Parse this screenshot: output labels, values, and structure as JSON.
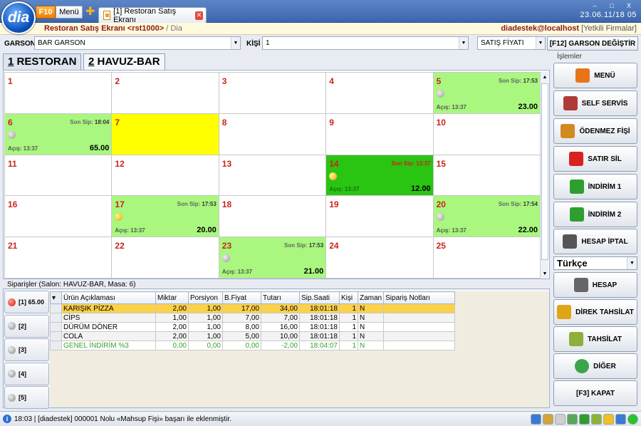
{
  "app": {
    "logo_text": "dia",
    "f10": "F10",
    "menu": "Menü",
    "tab_title": "[1] Restoran Satış Ekranı",
    "clock": "23.06.11/18 05"
  },
  "window_controls": {
    "minimize": "–",
    "maximize": "□",
    "close": "X"
  },
  "subbar": {
    "screen": "Restoran Satış Ekranı <rst1000>",
    "sep": " / ",
    "app": "Dia",
    "user": "diadestek@localhost",
    "firm": "[Yetkili Firmalar]"
  },
  "toolbar": {
    "garson_label": "GARSON",
    "garson_value": "BAR GARSON",
    "kisi_label": "KİŞİ",
    "kisi_value": "1",
    "price_value": "SATIŞ FİYATI",
    "change_button": "[F12] GARSON DEĞİŞTİR"
  },
  "salons": [
    {
      "key": "1",
      "label": " RESTORAN"
    },
    {
      "key": "2",
      "label": " HAVUZ-BAR"
    }
  ],
  "tables": [
    {
      "num": "1",
      "state": "free"
    },
    {
      "num": "2",
      "state": "free"
    },
    {
      "num": "3",
      "state": "free"
    },
    {
      "num": "4",
      "state": "free"
    },
    {
      "num": "5",
      "state": "busy",
      "last_label": "Son Sip:",
      "last": "17:53",
      "open": "Açış: 13:37",
      "total": "23.00",
      "dot": "gray"
    },
    {
      "num": "6",
      "state": "busy",
      "last_label": "Son Sip:",
      "last": "18:04",
      "open": "Açış: 13:37",
      "total": "65.00",
      "dot": "gray"
    },
    {
      "num": "7",
      "state": "reserved"
    },
    {
      "num": "8",
      "state": "free"
    },
    {
      "num": "9",
      "state": "free"
    },
    {
      "num": "10",
      "state": "free"
    },
    {
      "num": "11",
      "state": "free"
    },
    {
      "num": "12",
      "state": "free"
    },
    {
      "num": "13",
      "state": "free"
    },
    {
      "num": "14",
      "state": "active",
      "last_label": "Son Sip:",
      "last": "13:37",
      "open": "Açış: 13:37",
      "total": "12.00",
      "dot": "yellow"
    },
    {
      "num": "15",
      "state": "free"
    },
    {
      "num": "16",
      "state": "free"
    },
    {
      "num": "17",
      "state": "busy",
      "last_label": "Son Sip:",
      "last": "17:53",
      "open": "Açış: 13:37",
      "total": "20.00",
      "dot": "yellow"
    },
    {
      "num": "18",
      "state": "free"
    },
    {
      "num": "19",
      "state": "free"
    },
    {
      "num": "20",
      "state": "busy",
      "last_label": "Son Sip:",
      "last": "17:54",
      "open": "Açış: 13:37",
      "total": "22.00",
      "dot": "gray"
    },
    {
      "num": "21",
      "state": "free"
    },
    {
      "num": "22",
      "state": "free"
    },
    {
      "num": "23",
      "state": "busy",
      "last_label": "Son Sip:",
      "last": "17:53",
      "open": "Açış: 13:37",
      "total": "21.00",
      "dot": "gray"
    },
    {
      "num": "24",
      "state": "free"
    },
    {
      "num": "25",
      "state": "free"
    }
  ],
  "orders": {
    "title": "Siparişler (Salon: HAVUZ-BAR, Masa: 6)",
    "tabs": [
      {
        "label": "[1] 65.00",
        "active": true
      },
      {
        "label": "[2]"
      },
      {
        "label": "[3]"
      },
      {
        "label": "[4]"
      },
      {
        "label": "[5]"
      }
    ],
    "columns": [
      "Ürün Açıklaması",
      "Miktar",
      "Porsiyon",
      "B.Fiyat",
      "Tutarı",
      "Sip.Saati",
      "Kişi",
      "Zaman",
      "Sipariş Notları"
    ],
    "rows": [
      [
        "KARIŞIK PİZZA",
        "2,00",
        "1,00",
        "17,00",
        "34,00",
        "18:01:18",
        "1",
        "N",
        ""
      ],
      [
        "CİPS",
        "1,00",
        "1,00",
        "7,00",
        "7,00",
        "18:01:18",
        "1",
        "N",
        ""
      ],
      [
        "DÜRÜM DÖNER",
        "2,00",
        "1,00",
        "8,00",
        "16,00",
        "18:01:18",
        "1",
        "N",
        ""
      ],
      [
        "COLA",
        "2,00",
        "1,00",
        "5,00",
        "10,00",
        "18:01:18",
        "1",
        "N",
        ""
      ],
      [
        "GENEL İNDİRİM %3",
        "0,00",
        "0,00",
        "0,00",
        "-2,00",
        "18:04:07",
        "1",
        "N",
        ""
      ]
    ]
  },
  "panel": {
    "title": "İşlemler",
    "buttons": [
      {
        "label": "MENÜ",
        "icon": "food-icon",
        "color": "#e8741a"
      },
      {
        "label": "SELF SERVİS",
        "icon": "basket-icon",
        "color": "#b03a3a"
      },
      {
        "label": "ÖDENMEZ FİŞİ",
        "icon": "receipt-icon",
        "color": "#d08a20"
      },
      {
        "label": "SATIR SİL",
        "icon": "trash-icon",
        "color": "#d92121"
      },
      {
        "label": "İNDİRİM 1",
        "icon": "percent-icon",
        "color": "#2f9e2f"
      },
      {
        "label": "İNDİRİM 2",
        "icon": "dollar-icon",
        "color": "#2f9e2f"
      },
      {
        "label": "HESAP İPTAL",
        "icon": "printer-cancel-icon",
        "color": "#555555"
      }
    ],
    "language": "Türkçe",
    "buttons2": [
      {
        "label": "HESAP",
        "icon": "printer-icon",
        "color": "#666666"
      },
      {
        "label": "DİREK  TAHSİLAT",
        "icon": "coins-icon",
        "color": "#e0a516"
      },
      {
        "label": "TAHSİLAT",
        "icon": "cash-icon",
        "color": "#8fae3a"
      },
      {
        "label": "DİĞER",
        "icon": "arrow-right-icon",
        "color": "#3aa54a"
      },
      {
        "label": "[F3] KAPAT",
        "icon": "",
        "color": ""
      }
    ]
  },
  "status": {
    "text": "18:03 | [diadestek] 000001 Nolu «Mahsup Fişi» başarı ile eklenmiştir."
  }
}
